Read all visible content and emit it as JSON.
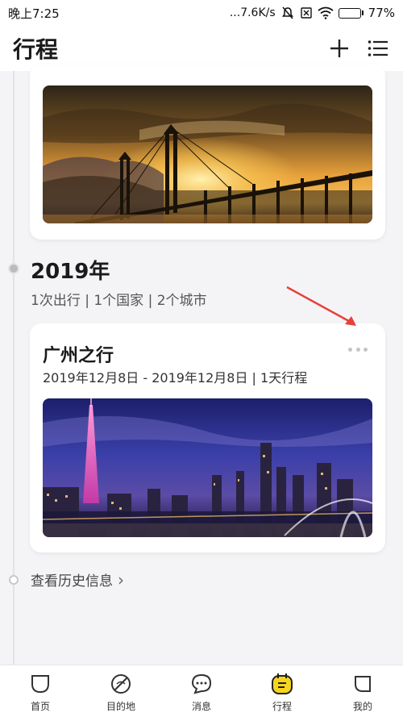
{
  "status_bar": {
    "time": "晚上7:25",
    "network_speed": "...7.6K/s",
    "battery": "77%",
    "battery_level": 0.77,
    "icons": [
      "mute-icon",
      "sim-icon",
      "wifi-icon",
      "battery-icon"
    ]
  },
  "header": {
    "title": "行程",
    "actions": [
      "add-icon",
      "list-icon"
    ]
  },
  "timeline": {
    "year": "2019年",
    "summary": "1次出行 | 1个国家 | 2个城市"
  },
  "trip_card": {
    "title": "广州之行",
    "dates": "2019年12月8日 - 2019年12月8日 | 1天行程",
    "more_icon": "more-dots-icon"
  },
  "history": {
    "label": "查看历史信息",
    "chevron": "›"
  },
  "bottom_nav": {
    "items": [
      {
        "label": "首页",
        "icon": "home-icon"
      },
      {
        "label": "目的地",
        "icon": "destination-icon"
      },
      {
        "label": "消息",
        "icon": "message-icon"
      },
      {
        "label": "行程",
        "icon": "trip-icon",
        "active": true
      },
      {
        "label": "我的",
        "icon": "profile-icon"
      }
    ]
  },
  "colors": {
    "accent": "#f7d51d",
    "annotation_arrow": "#e8403a",
    "background": "#f4f4f6"
  }
}
